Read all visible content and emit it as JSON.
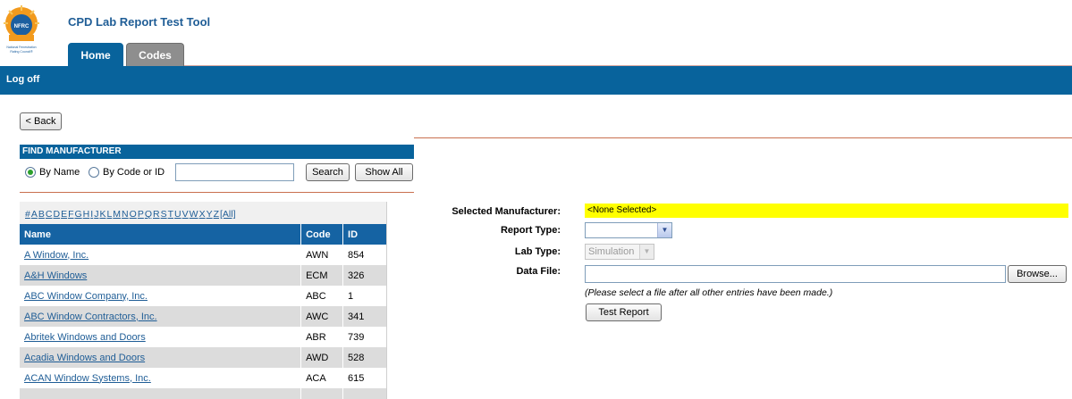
{
  "app": {
    "title": "CPD Lab Report Test Tool",
    "logo_text": "NFRC",
    "logo_caption": "National Fenestration Rating Council"
  },
  "tabs": [
    {
      "label": "Home",
      "active": true
    },
    {
      "label": "Codes",
      "active": false
    }
  ],
  "nav": {
    "logoff_label": "Log off"
  },
  "back_label": "< Back",
  "find": {
    "header": "FIND MANUFACTURER",
    "by_name_label": "By Name",
    "by_code_label": "By Code or ID",
    "search_value": "",
    "search_label": "Search",
    "showall_label": "Show All",
    "selected_mode": "by_name"
  },
  "alphabet": [
    "#",
    "A",
    "B",
    "C",
    "D",
    "E",
    "F",
    "G",
    "H",
    "I",
    "J",
    "K",
    "L",
    "M",
    "N",
    "O",
    "P",
    "Q",
    "R",
    "S",
    "T",
    "U",
    "V",
    "W",
    "X",
    "Y",
    "Z",
    "[All]"
  ],
  "table": {
    "columns": [
      "Name",
      "Code",
      "ID"
    ],
    "rows": [
      {
        "name": "A Window, Inc.",
        "code": "AWN",
        "id": "854"
      },
      {
        "name": "A&H Windows",
        "code": "ECM",
        "id": "326"
      },
      {
        "name": "ABC Window Company, Inc.",
        "code": "ABC",
        "id": "1"
      },
      {
        "name": "ABC Window Contractors, Inc.",
        "code": "AWC",
        "id": "341"
      },
      {
        "name": "Abritek Windows and Doors",
        "code": "ABR",
        "id": "739"
      },
      {
        "name": "Acadia Windows and Doors",
        "code": "AWD",
        "id": "528"
      },
      {
        "name": "ACAN Window Systems, Inc.",
        "code": "ACA",
        "id": "615"
      },
      {
        "name": "",
        "code": "",
        "id": ""
      }
    ]
  },
  "form": {
    "selected_label": "Selected Manufacturer:",
    "selected_value": "<None Selected>",
    "report_label": "Report Type:",
    "report_value": "",
    "lab_label": "Lab Type:",
    "lab_value": "Simulation",
    "data_label": "Data File:",
    "file_value": "",
    "browse_label": "Browse...",
    "hint": "(Please select a file after all other entries have been made.)",
    "test_label": "Test Report"
  },
  "colors": {
    "primary": "#08639c",
    "highlight": "#ffff00",
    "link": "#1f5d96",
    "divider": "#c9704f"
  }
}
